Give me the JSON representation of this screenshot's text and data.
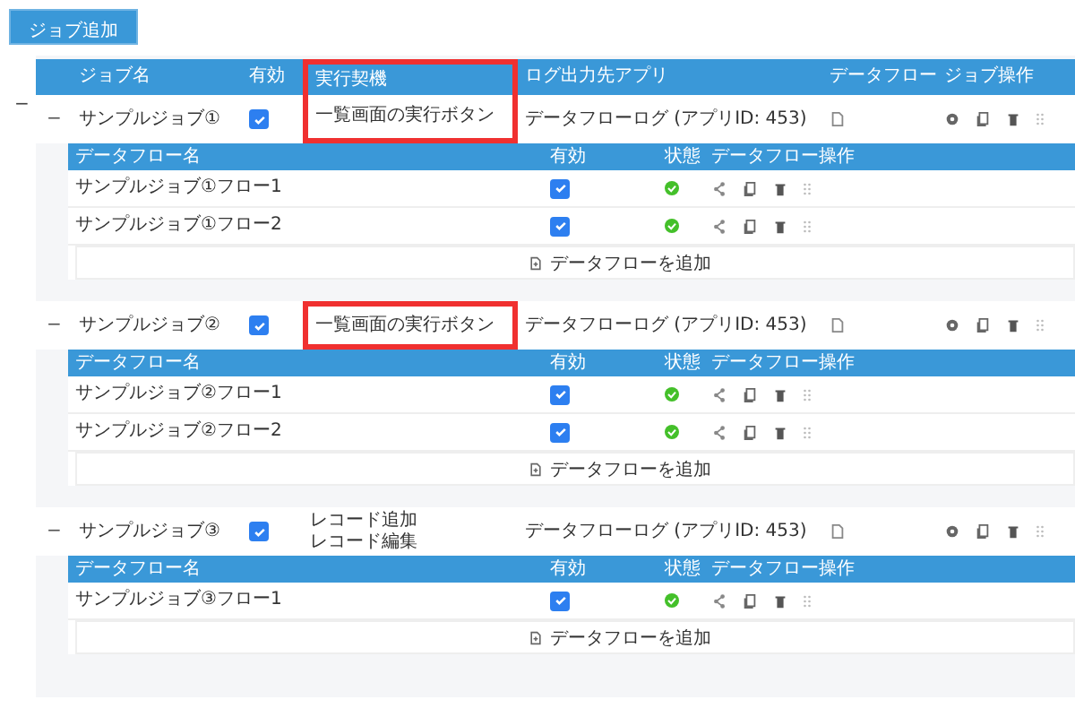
{
  "add_job_button": "ジョブ追加",
  "root_toggle": "−",
  "job_columns": [
    {
      "label": "ジョブ名",
      "highlighted": false
    },
    {
      "label": "有効",
      "highlighted": false
    },
    {
      "label": "実行契機",
      "highlighted": true
    },
    {
      "label": "ログ出力先アプリ",
      "highlighted": false
    },
    {
      "label": "データフロー",
      "highlighted": false
    },
    {
      "label": "ジョブ操作",
      "highlighted": false
    }
  ],
  "jobs": [
    {
      "toggle": "−",
      "name": "サンプルジョブ①",
      "enabled": true,
      "triggers": [
        "一覧画面の実行ボタン"
      ],
      "highlighted": true,
      "app": "データフローログ (アプリID: 453)",
      "flow_columns": [
        "データフロー名",
        "有効",
        "状態",
        "データフロー操作"
      ],
      "flows": [
        {
          "name": "サンプルジョブ①フロー1",
          "enabled": true,
          "ok": true
        },
        {
          "name": "サンプルジョブ①フロー2",
          "enabled": true,
          "ok": true
        }
      ],
      "add_flow": "データフローを追加"
    },
    {
      "toggle": "−",
      "name": "サンプルジョブ②",
      "enabled": true,
      "triggers": [
        "一覧画面の実行ボタン"
      ],
      "highlighted": true,
      "app": "データフローログ (アプリID: 453)",
      "flow_columns": [
        "データフロー名",
        "有効",
        "状態",
        "データフロー操作"
      ],
      "flows": [
        {
          "name": "サンプルジョブ②フロー1",
          "enabled": true,
          "ok": true
        },
        {
          "name": "サンプルジョブ②フロー2",
          "enabled": true,
          "ok": true
        }
      ],
      "add_flow": "データフローを追加"
    },
    {
      "toggle": "−",
      "name": "サンプルジョブ③",
      "enabled": true,
      "triggers": [
        "レコード追加",
        "レコード編集"
      ],
      "highlighted": false,
      "app": "データフローログ (アプリID: 453)",
      "flow_columns": [
        "データフロー名",
        "有効",
        "状態",
        "データフロー操作"
      ],
      "flows": [
        {
          "name": "サンプルジョブ③フロー1",
          "enabled": true,
          "ok": true
        }
      ],
      "add_flow": "データフローを追加"
    }
  ]
}
